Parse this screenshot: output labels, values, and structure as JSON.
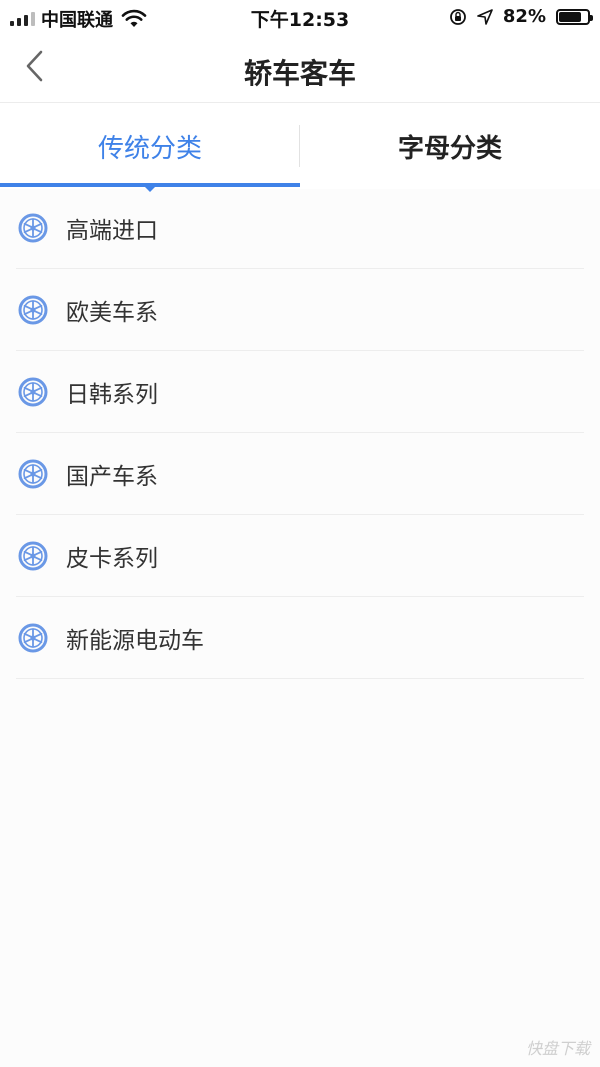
{
  "status_bar": {
    "carrier": "中国联通",
    "time": "下午12:53",
    "battery_percent": "82%",
    "battery_level": 0.82
  },
  "nav": {
    "title": "轿车客车"
  },
  "tabs": [
    {
      "label": "传统分类",
      "active": true
    },
    {
      "label": "字母分类",
      "active": false
    }
  ],
  "categories": [
    {
      "label": "高端进口"
    },
    {
      "label": "欧美车系"
    },
    {
      "label": "日韩系列"
    },
    {
      "label": "国产车系"
    },
    {
      "label": "皮卡系列"
    },
    {
      "label": "新能源电动车"
    }
  ],
  "watermark": "快盘下载",
  "colors": {
    "accent": "#3f82e8",
    "icon": "#6a98e6",
    "text": "#333333"
  }
}
